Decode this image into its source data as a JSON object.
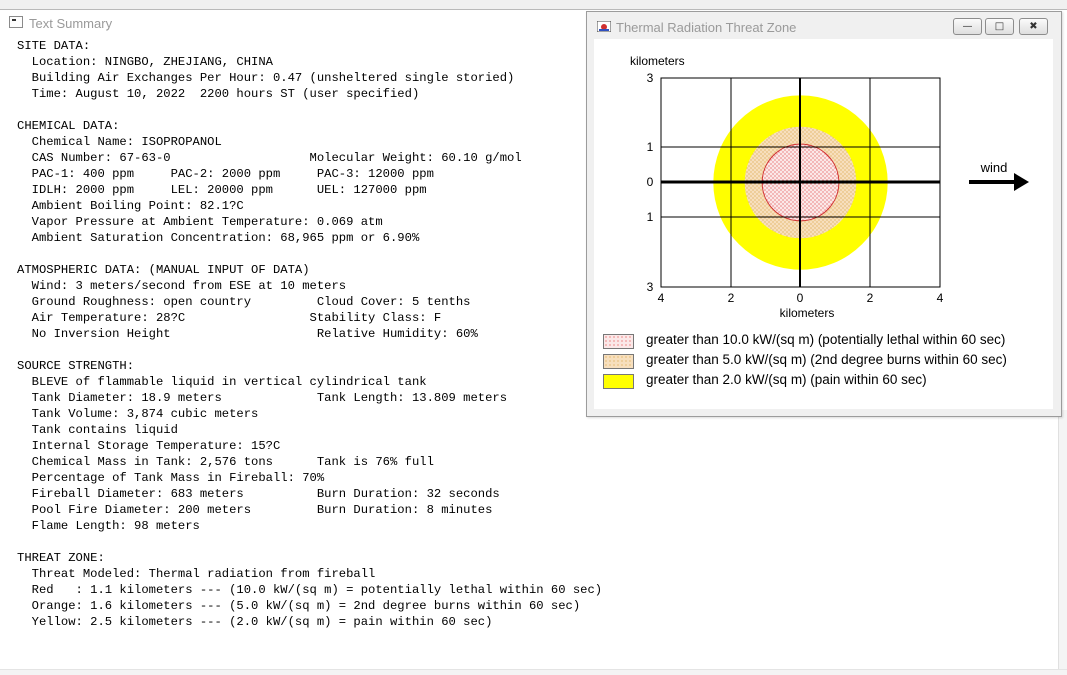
{
  "text_window": {
    "title": "Text Summary",
    "lines": [
      "SITE DATA:",
      "  Location: NINGBO, ZHEJIANG, CHINA",
      "  Building Air Exchanges Per Hour: 0.47 (unsheltered single storied)",
      "  Time: August 10, 2022  2200 hours ST (user specified)",
      "",
      "CHEMICAL DATA:",
      "  Chemical Name: ISOPROPANOL",
      "  CAS Number: 67-63-0                   Molecular Weight: 60.10 g/mol",
      "  PAC-1: 400 ppm     PAC-2: 2000 ppm     PAC-3: 12000 ppm",
      "  IDLH: 2000 ppm     LEL: 20000 ppm      UEL: 127000 ppm",
      "  Ambient Boiling Point: 82.1?C",
      "  Vapor Pressure at Ambient Temperature: 0.069 atm",
      "  Ambient Saturation Concentration: 68,965 ppm or 6.90%",
      "",
      "ATMOSPHERIC DATA: (MANUAL INPUT OF DATA)",
      "  Wind: 3 meters/second from ESE at 10 meters",
      "  Ground Roughness: open country         Cloud Cover: 5 tenths",
      "  Air Temperature: 28?C                 Stability Class: F",
      "  No Inversion Height                    Relative Humidity: 60%",
      "",
      "SOURCE STRENGTH:",
      "  BLEVE of flammable liquid in vertical cylindrical tank",
      "  Tank Diameter: 18.9 meters             Tank Length: 13.809 meters",
      "  Tank Volume: 3,874 cubic meters",
      "  Tank contains liquid",
      "  Internal Storage Temperature: 15?C",
      "  Chemical Mass in Tank: 2,576 tons      Tank is 76% full",
      "  Percentage of Tank Mass in Fireball: 70%",
      "  Fireball Diameter: 683 meters          Burn Duration: 32 seconds",
      "  Pool Fire Diameter: 200 meters         Burn Duration: 8 minutes",
      "  Flame Length: 98 meters",
      "",
      "THREAT ZONE:",
      "  Threat Modeled: Thermal radiation from fireball",
      "  Red   : 1.1 kilometers --- (10.0 kW/(sq m) = potentially lethal within 60 sec)",
      "  Orange: 1.6 kilometers --- (5.0 kW/(sq m) = 2nd degree burns within 60 sec)",
      "  Yellow: 2.5 kilometers --- (2.0 kW/(sq m) = pain within 60 sec)"
    ]
  },
  "threat_window": {
    "title": "Thermal Radiation Threat Zone",
    "buttons": {
      "minimize": "—",
      "maximize": "□",
      "close": "✖"
    },
    "axis_label_y": "kilometers",
    "axis_label_x": "kilometers",
    "y_ticks": [
      "3",
      "1",
      "0",
      "1",
      "3"
    ],
    "x_ticks": [
      "4",
      "2",
      "0",
      "2",
      "4"
    ],
    "wind_label": "wind",
    "legend": [
      {
        "label": "greater than 10.0 kW/(sq m) (potentially lethal within 60 sec)",
        "color": "#e04040",
        "fill": "#fbe8e8"
      },
      {
        "label": "greater than 5.0 kW/(sq m) (2nd degree burns within 60 sec)",
        "color": "#d8a040",
        "fill": "#f7dfbd"
      },
      {
        "label": "greater than 2.0 kW/(sq m) (pain within 60 sec)",
        "color": "#d7d700",
        "fill": "#ffff00"
      }
    ],
    "zones_km": {
      "red": 1.1,
      "orange": 1.6,
      "yellow": 2.5
    },
    "x_range_km": [
      -4,
      4
    ],
    "y_range_km": [
      -3,
      3
    ]
  }
}
